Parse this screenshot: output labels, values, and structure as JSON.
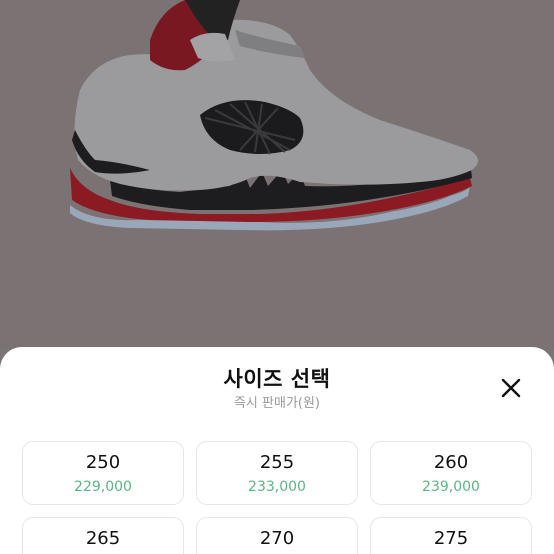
{
  "sheet": {
    "title": "사이즈 선택",
    "subtitle": "즉시 판매가(원)",
    "close_icon": "close-icon"
  },
  "sizes": [
    {
      "size": "250",
      "price": "229,000"
    },
    {
      "size": "255",
      "price": "233,000"
    },
    {
      "size": "260",
      "price": "239,000"
    },
    {
      "size": "265",
      "price": ""
    },
    {
      "size": "270",
      "price": ""
    },
    {
      "size": "275",
      "price": ""
    }
  ],
  "colors": {
    "price_green": "#5bb584",
    "overlay_bg": "#7a7273",
    "shoe_red": "#c8102e"
  }
}
